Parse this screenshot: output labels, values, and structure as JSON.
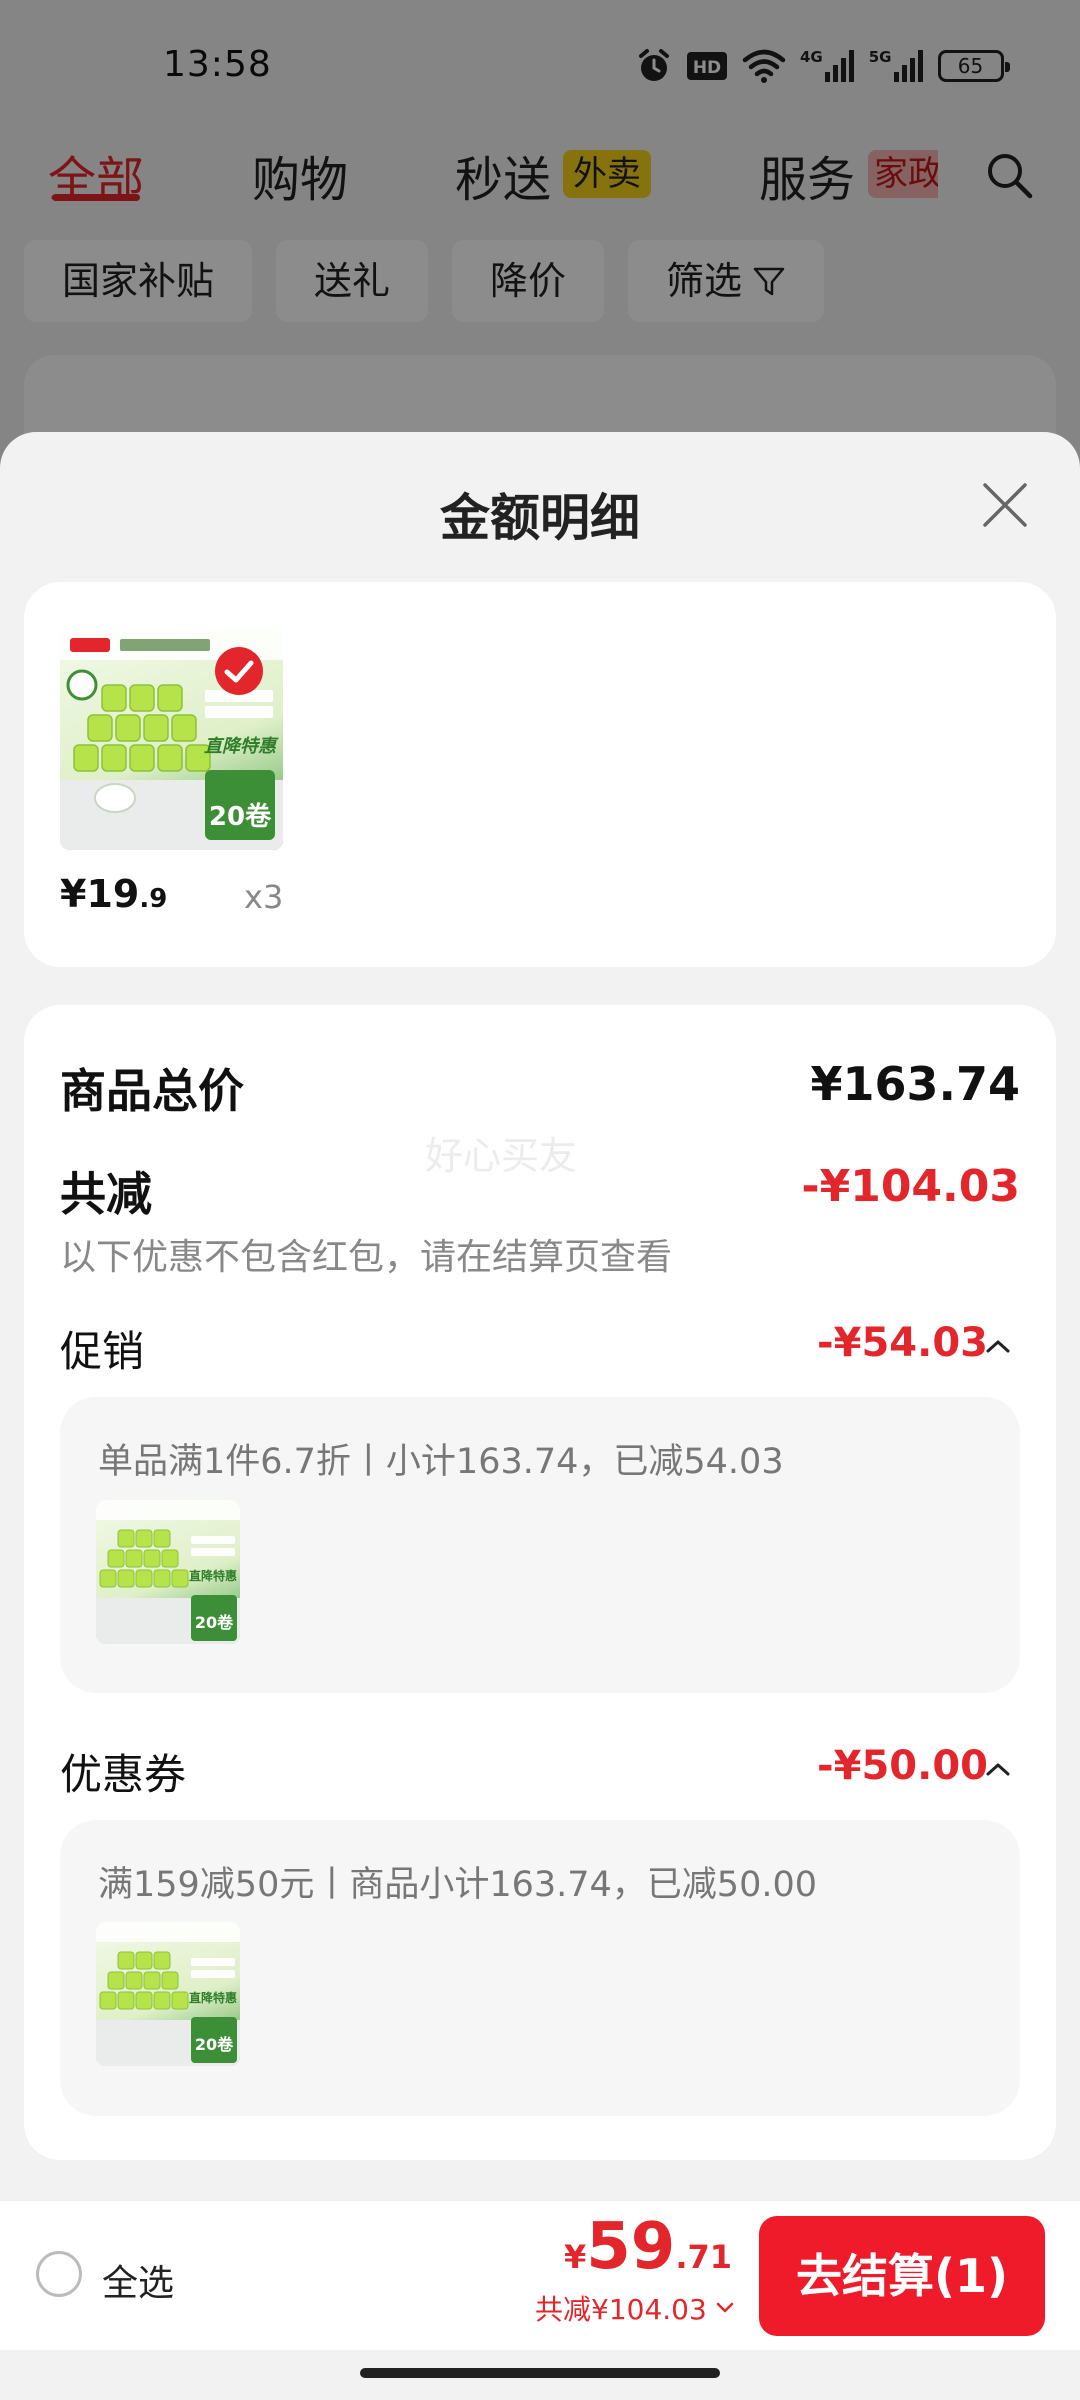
{
  "status_bar": {
    "time": "13:58",
    "net_4g": "4G",
    "net_5g": "5G",
    "battery": "65"
  },
  "tabs": [
    {
      "label": "全部"
    },
    {
      "label": "购物"
    },
    {
      "label": "秒送"
    },
    {
      "label": "服务"
    }
  ],
  "tab_badges": {
    "waimai": "外卖",
    "jiazheng": "家政"
  },
  "chips": [
    {
      "label": "国家补贴"
    },
    {
      "label": "送礼"
    },
    {
      "label": "降价"
    },
    {
      "label": "筛选"
    }
  ],
  "sheet": {
    "title": "金额明细",
    "product": {
      "price_symbol": "¥",
      "price_int": "19",
      "price_dec": ".9",
      "quantity": "x3"
    },
    "total_label": "商品总价",
    "total_value": "¥163.74",
    "reduce_label": "共减",
    "reduce_value": "-¥104.03",
    "note": "以下优惠不包含红包，请在结算页查看",
    "watermark": "好心买友",
    "promo": {
      "label": "促销",
      "value": "-¥54.03",
      "detail": "单品满1件6.7折丨小计163.74，已减54.03"
    },
    "coupon": {
      "label": "优惠券",
      "value": "-¥50.00",
      "detail": "满159减50元丨商品小计163.74，已减50.00"
    }
  },
  "bottom_bar": {
    "select_all": "全选",
    "price_symbol": "¥",
    "price_int": "59",
    "price_dec": ".71",
    "reduce_text": "共减¥104.03",
    "checkout_label": "去结算(1)"
  },
  "colors": {
    "accent": "#e3262b",
    "checkout": "#f01b2a",
    "product_green": "#4ea34a"
  }
}
